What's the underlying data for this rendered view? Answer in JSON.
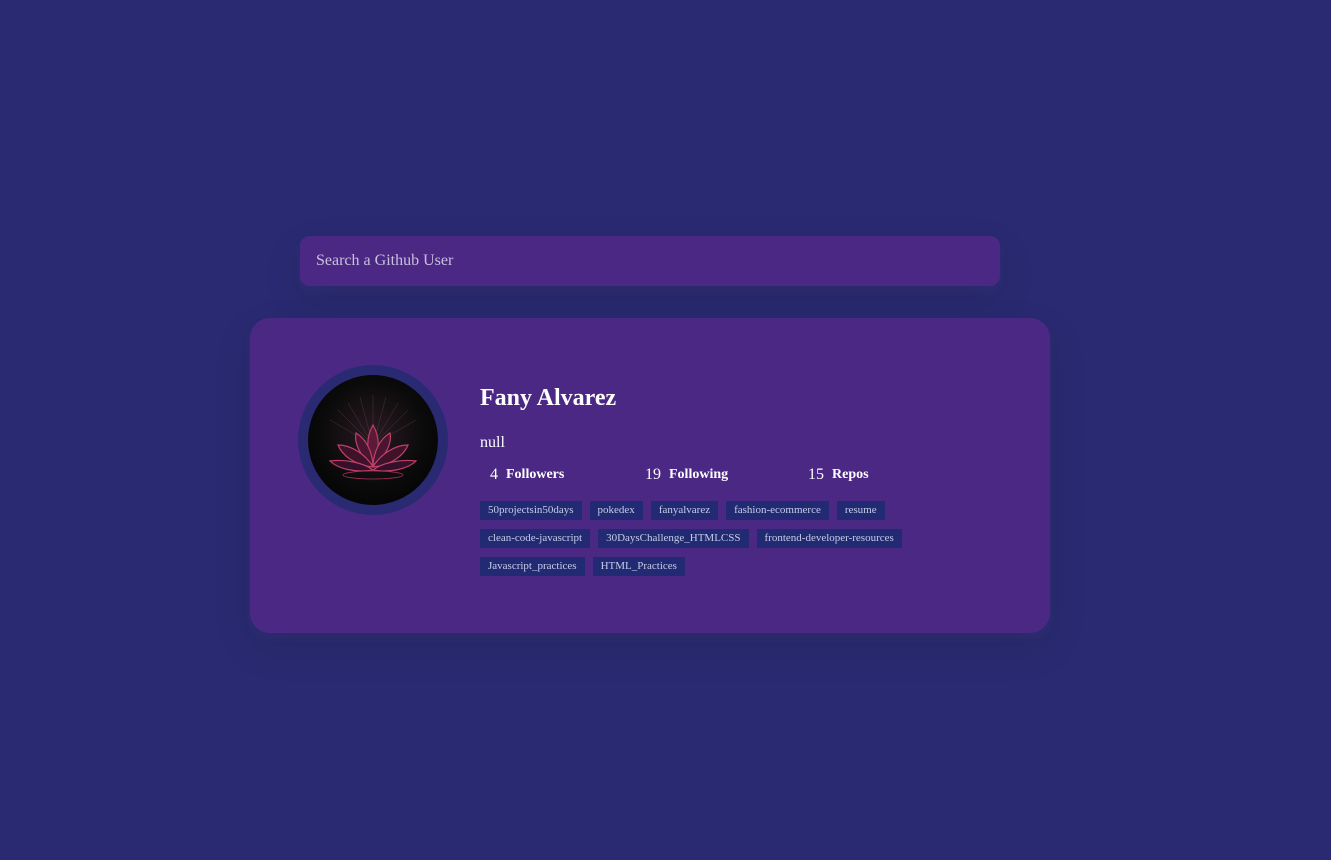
{
  "search": {
    "placeholder": "Search a Github User"
  },
  "profile": {
    "name": "Fany Alvarez",
    "bio": "null",
    "avatar_icon": "lotus-avatar-icon",
    "stats": [
      {
        "value": "4",
        "label": "Followers"
      },
      {
        "value": "19",
        "label": "Following"
      },
      {
        "value": "15",
        "label": "Repos"
      }
    ]
  },
  "repos": [
    "50projectsin50days",
    "pokedex",
    "fanyalvarez",
    "fashion-ecommerce",
    "resume",
    "clean-code-javascript",
    "30DaysChallenge_HTMLCSS",
    "frontend-developer-resources",
    "Javascript_practices",
    "HTML_Practices"
  ],
  "colors": {
    "background": "#2a2a72",
    "card": "#4c2885",
    "repo_tag": "#212a72",
    "text": "#ffffff"
  }
}
